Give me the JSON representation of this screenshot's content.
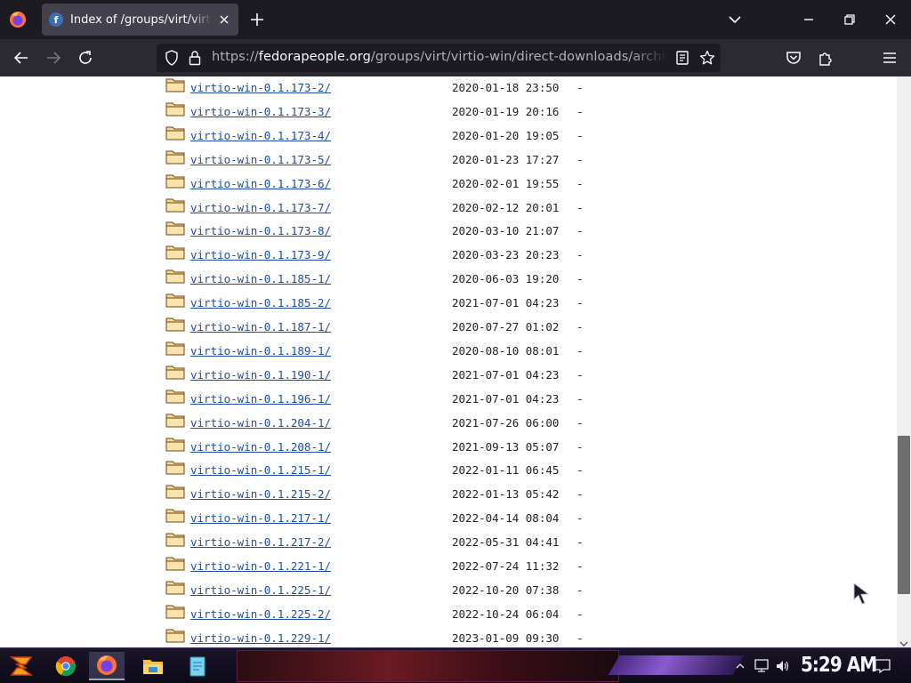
{
  "window": {
    "tab_title": "Index of /groups/virt/virtio-win/direct-downloads/archive-virtio",
    "address_scheme": "https://",
    "address_host": "fedorapeople.org",
    "address_path": "/groups/virt/virtio-win/direct-downloads/archive-virtio"
  },
  "directory": {
    "rows": [
      {
        "name": "virtio-win-0.1.173-2/",
        "modified": "2020-01-18 23:50",
        "size": "-"
      },
      {
        "name": "virtio-win-0.1.173-3/",
        "modified": "2020-01-19 20:16",
        "size": "-"
      },
      {
        "name": "virtio-win-0.1.173-4/",
        "modified": "2020-01-20 19:05",
        "size": "-"
      },
      {
        "name": "virtio-win-0.1.173-5/",
        "modified": "2020-01-23 17:27",
        "size": "-"
      },
      {
        "name": "virtio-win-0.1.173-6/",
        "modified": "2020-02-01 19:55",
        "size": "-"
      },
      {
        "name": "virtio-win-0.1.173-7/",
        "modified": "2020-02-12 20:01",
        "size": "-"
      },
      {
        "name": "virtio-win-0.1.173-8/",
        "modified": "2020-03-10 21:07",
        "size": "-"
      },
      {
        "name": "virtio-win-0.1.173-9/",
        "modified": "2020-03-23 20:23",
        "size": "-"
      },
      {
        "name": "virtio-win-0.1.185-1/",
        "modified": "2020-06-03 19:20",
        "size": "-"
      },
      {
        "name": "virtio-win-0.1.185-2/",
        "modified": "2021-07-01 04:23",
        "size": "-"
      },
      {
        "name": "virtio-win-0.1.187-1/",
        "modified": "2020-07-27 01:02",
        "size": "-"
      },
      {
        "name": "virtio-win-0.1.189-1/",
        "modified": "2020-08-10 08:01",
        "size": "-"
      },
      {
        "name": "virtio-win-0.1.190-1/",
        "modified": "2021-07-01 04:23",
        "size": "-"
      },
      {
        "name": "virtio-win-0.1.196-1/",
        "modified": "2021-07-01 04:23",
        "size": "-"
      },
      {
        "name": "virtio-win-0.1.204-1/",
        "modified": "2021-07-26 06:00",
        "size": "-"
      },
      {
        "name": "virtio-win-0.1.208-1/",
        "modified": "2021-09-13 05:07",
        "size": "-"
      },
      {
        "name": "virtio-win-0.1.215-1/",
        "modified": "2022-01-11 06:45",
        "size": "-"
      },
      {
        "name": "virtio-win-0.1.215-2/",
        "modified": "2022-01-13 05:42",
        "size": "-"
      },
      {
        "name": "virtio-win-0.1.217-1/",
        "modified": "2022-04-14 08:04",
        "size": "-"
      },
      {
        "name": "virtio-win-0.1.217-2/",
        "modified": "2022-05-31 04:41",
        "size": "-"
      },
      {
        "name": "virtio-win-0.1.221-1/",
        "modified": "2022-07-24 11:32",
        "size": "-"
      },
      {
        "name": "virtio-win-0.1.225-1/",
        "modified": "2022-10-20 07:38",
        "size": "-"
      },
      {
        "name": "virtio-win-0.1.225-2/",
        "modified": "2022-10-24 06:04",
        "size": "-"
      },
      {
        "name": "virtio-win-0.1.229-1/",
        "modified": "2023-01-09 09:30",
        "size": "-"
      }
    ]
  },
  "icons": {
    "browser": "firefox-icon",
    "tab_favicon": "fedora-icon",
    "new_tab": "plus-icon",
    "list_tabs": "chevron-down-icon",
    "back": "back-arrow-icon",
    "forward": "forward-arrow-icon",
    "reload": "reload-icon",
    "tracking": "shield-icon",
    "lock": "lock-icon",
    "reader": "reader-view-icon",
    "bookmark": "star-icon",
    "pocket": "pocket-icon",
    "extensions": "puzzle-icon",
    "menu": "hamburger-icon",
    "folder": "folder-icon"
  },
  "taskbar": {
    "clock": "5:29 AM",
    "apps": [
      "start-icon",
      "chrome-icon",
      "firefox-icon",
      "file-explorer-icon",
      "notepad-icon"
    ]
  },
  "colors": {
    "link": "#1f4ea8",
    "tab_active": "#42414d",
    "toolbar": "#2b2a33",
    "tabstrip": "#1c1b22"
  }
}
